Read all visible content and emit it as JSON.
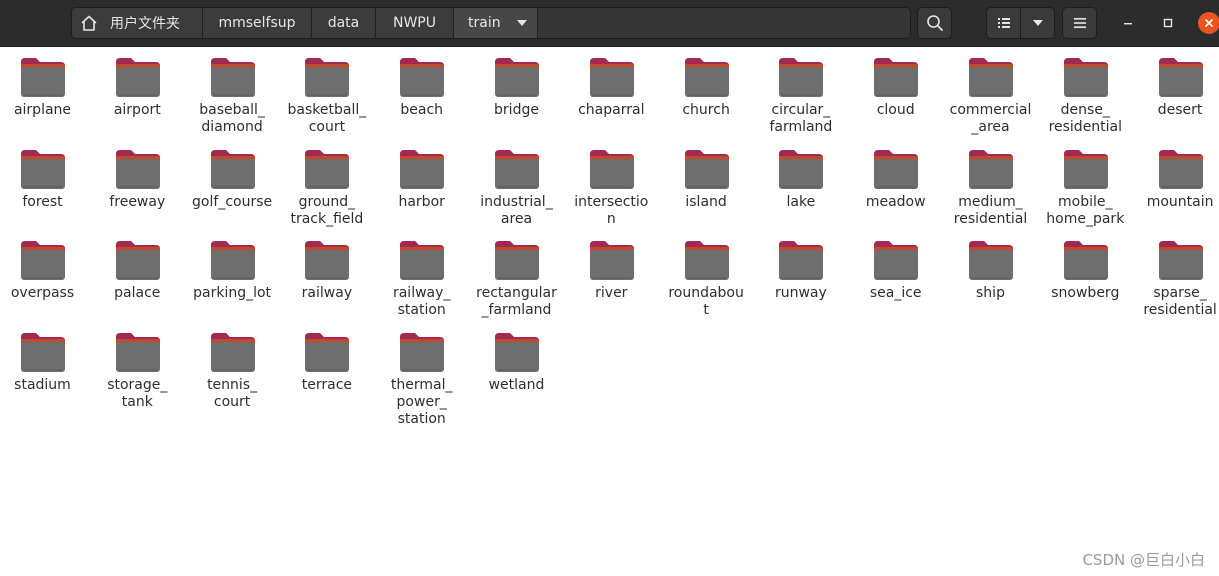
{
  "pathbar": {
    "crumbs": [
      "用户文件夹",
      "mmselfsup",
      "data",
      "NWPU",
      "train"
    ]
  },
  "icons": {
    "home": "home-icon",
    "search": "search-icon",
    "view": "list-view-icon",
    "view_dropdown": "chevron-down-icon",
    "menu": "hamburger-menu-icon",
    "minimize": "minimize-icon",
    "maximize": "maximize-icon",
    "close": "close-icon",
    "folder": "folder-icon"
  },
  "colors": {
    "headerbar": "#2c2c2c",
    "folder_tab": "#a22a52",
    "folder_body": "#6e6e6e",
    "close_button": "#e95420"
  },
  "folders": [
    "airplane",
    "airport",
    "baseball_\ndiamond",
    "basketball_\ncourt",
    "beach",
    "bridge",
    "chaparral",
    "church",
    "circular_\nfarmland",
    "cloud",
    "commercial\n_area",
    "dense_\nresidential",
    "desert",
    "forest",
    "freeway",
    "golf_course",
    "ground_\ntrack_field",
    "harbor",
    "industrial_\narea",
    "intersectio\nn",
    "island",
    "lake",
    "meadow",
    "medium_\nresidential",
    "mobile_\nhome_park",
    "mountain",
    "overpass",
    "palace",
    "parking_lot",
    "railway",
    "railway_\nstation",
    "rectangular\n_farmland",
    "river",
    "roundabou\nt",
    "runway",
    "sea_ice",
    "ship",
    "snowberg",
    "sparse_\nresidential",
    "stadium",
    "storage_\ntank",
    "tennis_\ncourt",
    "terrace",
    "thermal_\npower_\nstation",
    "wetland"
  ],
  "watermark": "CSDN @巨白小白"
}
